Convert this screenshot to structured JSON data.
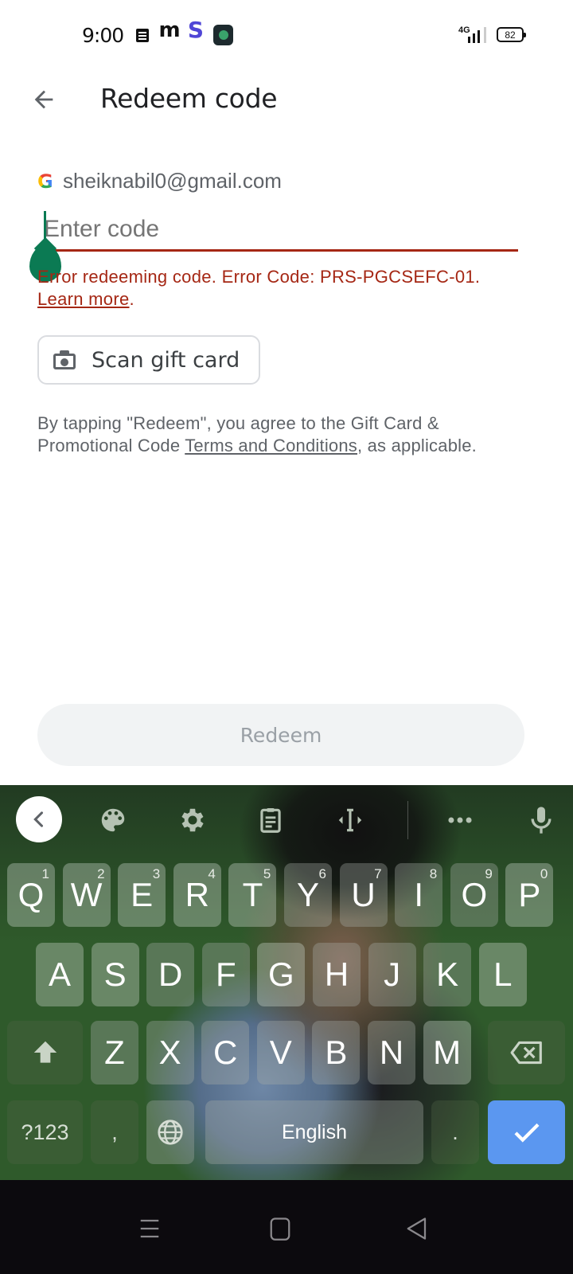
{
  "status_bar": {
    "time": "9:00",
    "notification_icons": [
      "notes-icon",
      "m-app-icon",
      "s-app-icon",
      "shield-app-icon"
    ],
    "network": "4G",
    "battery_level": "82",
    "s_app_color": "#5046d6"
  },
  "app_bar": {
    "title": "Redeem code",
    "back_icon": "arrow-left-icon"
  },
  "account": {
    "email": "sheiknabil0@gmail.com",
    "provider_icon": "google-g-icon",
    "logo_letter": "G"
  },
  "code_input": {
    "value": "",
    "placeholder": "Enter code",
    "error_color": "#a52714",
    "cursor_color": "#0b7a53"
  },
  "error": {
    "message": "Error redeeming code. Error Code: PRS-PGCSEFC-01.",
    "link_label": "Learn more",
    "suffix": "."
  },
  "scan_button": {
    "label": "Scan gift card",
    "icon": "camera-icon"
  },
  "terms": {
    "prefix": "By tapping \"Redeem\", you agree to the Gift Card & Promotional Code ",
    "link_label": "Terms and Conditions",
    "suffix": ", as applicable."
  },
  "redeem_button": {
    "label": "Redeem",
    "enabled": false
  },
  "keyboard": {
    "toolbar": [
      "collapse-icon",
      "palette-icon",
      "settings-icon",
      "clipboard-icon",
      "cursor-move-icon",
      "more-icon",
      "microphone-icon"
    ],
    "row1": [
      {
        "key": "Q",
        "hint": "1"
      },
      {
        "key": "W",
        "hint": "2"
      },
      {
        "key": "E",
        "hint": "3"
      },
      {
        "key": "R",
        "hint": "4"
      },
      {
        "key": "T",
        "hint": "5"
      },
      {
        "key": "Y",
        "hint": "6"
      },
      {
        "key": "U",
        "hint": "7"
      },
      {
        "key": "I",
        "hint": "8"
      },
      {
        "key": "O",
        "hint": "9"
      },
      {
        "key": "P",
        "hint": "0"
      }
    ],
    "row2": [
      "A",
      "S",
      "D",
      "F",
      "G",
      "H",
      "J",
      "K",
      "L"
    ],
    "row3": [
      "Z",
      "X",
      "C",
      "V",
      "B",
      "N",
      "M"
    ],
    "symbols_label": "?123",
    "comma": ",",
    "space_label": "English",
    "period": ".",
    "enter_color": "#5b97f0"
  },
  "nav_bar": {
    "buttons": [
      "recents-icon",
      "home-icon",
      "back-icon"
    ]
  }
}
